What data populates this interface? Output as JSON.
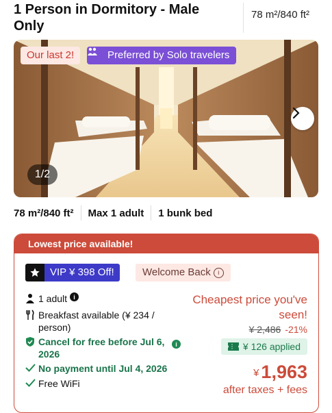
{
  "header": {
    "title": "1 Person in Dormitory - Male Only",
    "size": "78 m²/840 ft²"
  },
  "photo": {
    "badge_last": "Our last 2!",
    "badge_solo": "Preferred by Solo travelers",
    "counter": "1/2"
  },
  "facts": {
    "size": "78 m²/840 ft²",
    "occupancy": "Max 1 adult",
    "bed": "1 bunk bed"
  },
  "offer": {
    "banner": "Lowest price available!",
    "vip": "VIP ¥ 398 Off!",
    "welcome": "Welcome Back",
    "features": {
      "adults": "1 adult",
      "breakfast": "Breakfast available (¥ 234 / person)",
      "cancel": "Cancel for free before Jul 6, 2026",
      "payment": "No payment until Jul 4, 2026",
      "wifi": "Free WiFi"
    },
    "pricing": {
      "headline": "Cheapest price you've seen!",
      "old_price": "¥ 2,486",
      "discount": "-21%",
      "applied": "¥ 126 applied",
      "currency": "¥",
      "price": "1,963",
      "after": "after taxes + fees"
    }
  },
  "colors": {
    "accent_red": "#cc4b3a",
    "vip_blue": "#3d3ac8",
    "solo_purple": "#7b4fd6",
    "green": "#19734a"
  }
}
